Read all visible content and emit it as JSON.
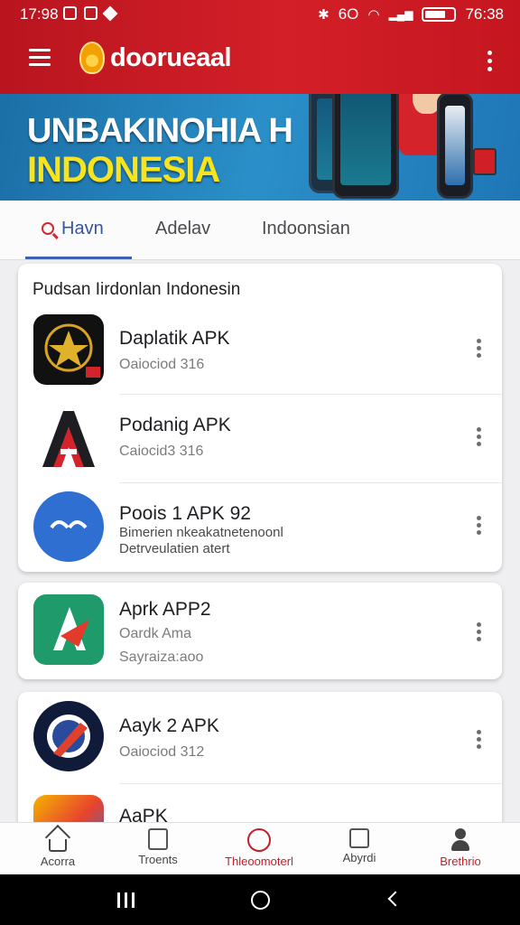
{
  "status_bar": {
    "time_left": "17:98",
    "signal_text": "6O",
    "time_right": "76:38"
  },
  "app_bar": {
    "brand": "doorueaal"
  },
  "banner": {
    "line1": "UNBAKINOHIA  H",
    "line2": "INDONESIA"
  },
  "tabs": [
    {
      "label": "Havn",
      "active": true
    },
    {
      "label": "Adelav",
      "active": false
    },
    {
      "label": "Indoonsian",
      "active": false
    }
  ],
  "section": {
    "title": "Pudsan Iirdonlan Indonesin"
  },
  "apps_card1": [
    {
      "name": "Daplatik APK",
      "sub": "Oaiociod 316",
      "icon": "star-emblem-icon"
    },
    {
      "name": "Podanig APK",
      "sub": "Caiocid3 316",
      "icon": "letter-a-icon"
    },
    {
      "name": "Pooіs 1 APK 92",
      "sub": "Bimerien nkeakatnetenoonl",
      "sub2": "Detrveulatien atert",
      "icon": "blue-circle-icon"
    }
  ],
  "apps_card2": [
    {
      "name": "Aprk APP2",
      "sub": "Oardk Ama",
      "sub2": "Sayraiza:aoo",
      "icon": "green-arrow-icon"
    }
  ],
  "apps_card3": [
    {
      "name": "Aayk 2 APK",
      "sub": "Oaiociod 312",
      "icon": "navy-badge-icon"
    },
    {
      "name": "AaPK",
      "icon": "colorful-icon"
    }
  ],
  "bottom_nav": [
    {
      "label": "Acorra",
      "icon": "home-icon"
    },
    {
      "label": "Troents",
      "icon": "box-icon"
    },
    {
      "label": "Thleoomoterl",
      "icon": "circle-icon",
      "active": true
    },
    {
      "label": "Abyrdi",
      "icon": "square-icon"
    },
    {
      "label": "Brethrio",
      "icon": "person-icon",
      "active": true
    }
  ],
  "colors": {
    "header_red": "#c5161f",
    "banner_blue": "#2a8fc8",
    "banner_yellow": "#f7e41c",
    "tab_active": "#3556a3",
    "nav_active": "#c41f28"
  }
}
